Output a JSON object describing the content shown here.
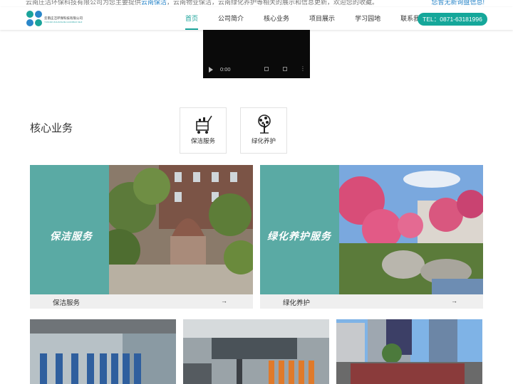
{
  "topbar": {
    "intro_before": "云南庄洁环保科技有限公司为您主要提供",
    "intro_highlight": "云南保洁",
    "intro_after": "，云南物业保洁，云南绿化养护等相关的展示和信息更新，欢迎您的收藏。",
    "inquiry_notice": "您暂无新询盘信息!"
  },
  "logo": {
    "company_name": "云南庄洁环保科技有限公司",
    "subtitle": "YUNNAN ZHUANGJIE HUANBAO KEJI"
  },
  "nav": {
    "items": [
      "首页",
      "公司简介",
      "核心业务",
      "项目展示",
      "学习园地",
      "联系我们"
    ],
    "active_index": 0
  },
  "contact": {
    "tel_label": "TEL：0871-63181996"
  },
  "video": {
    "time": "0:00"
  },
  "section": {
    "title": "核心业务"
  },
  "services": [
    {
      "icon": "cleaning-cart-icon",
      "label": "保洁服务"
    },
    {
      "icon": "tree-icon",
      "label": "绿化养护"
    }
  ],
  "cards": [
    {
      "banner": "保洁服务",
      "caption": "保洁服务",
      "arrow": "→"
    },
    {
      "banner": "绿化养护服务",
      "caption": "绿化养护",
      "arrow": "→"
    }
  ],
  "colors": {
    "accent": "#15a79a",
    "card_teal": "#5aaaa4",
    "link_blue": "#2a86c9"
  }
}
